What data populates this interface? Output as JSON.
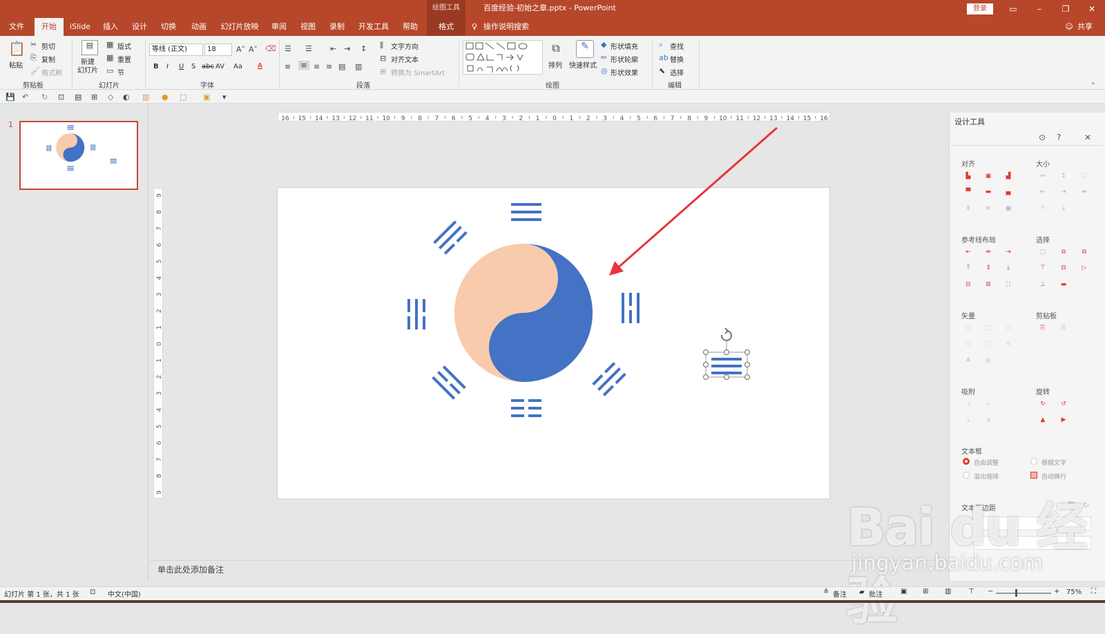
{
  "titlebar": {
    "context_group": "绘图工具",
    "document_title": "百度经验-初始之章.pptx  -  PowerPoint",
    "login_label": "登录",
    "share_label": "共享"
  },
  "tabs": [
    "文件",
    "开始",
    "iSlide",
    "插入",
    "设计",
    "切换",
    "动画",
    "幻灯片放映",
    "审阅",
    "视图",
    "录制",
    "开发工具",
    "帮助",
    "格式"
  ],
  "tell_me": "操作说明搜索",
  "ribbon": {
    "clipboard": {
      "label": "剪贴板",
      "paste": "粘贴",
      "cut": "剪切",
      "copy": "复制",
      "format_painter": "格式刷"
    },
    "slides": {
      "label": "幻灯片",
      "new_slide": "新建\n幻灯片",
      "layout": "版式",
      "reset": "重置",
      "section": "节"
    },
    "font": {
      "label": "字体",
      "font_name": "等线 (正文)",
      "font_size": "18",
      "bold": "B",
      "italic": "I",
      "underline": "U",
      "shadow": "S",
      "strike": "abc",
      "spacing": "AV",
      "case": "Aa",
      "color": "A"
    },
    "paragraph": {
      "label": "段落",
      "text_direction": "文字方向",
      "align_text": "对齐文本",
      "convert_smartart": "转换为 SmartArt"
    },
    "drawing": {
      "label": "绘图",
      "arrange": "排列",
      "quick_styles": "快速样式",
      "shape_fill": "形状填充",
      "shape_outline": "形状轮廓",
      "shape_effects": "形状效果"
    },
    "editing": {
      "label": "编辑",
      "find": "查找",
      "replace": "替换",
      "select": "选择"
    }
  },
  "slide_panel": {
    "slide_number": "1"
  },
  "notes_placeholder": "单击此处添加备注",
  "design_pane": {
    "title": "设计工具",
    "sections": {
      "align": "对齐",
      "size": "大小",
      "guide_layout": "参考线布局",
      "select": "选择",
      "vector": "矢量",
      "clipboard": "剪贴板",
      "snap": "吸附",
      "rotate": "旋转",
      "textbox": "文本框",
      "textbox_margin": "文本框边距"
    },
    "textbox_options": {
      "auto_fit": "自由调整",
      "fit_text": "根据文字",
      "overflow_shrink": "溢出缩排",
      "auto_wrap": "自动换行"
    }
  },
  "ruler": {
    "h_ticks": [
      "16",
      "15",
      "14",
      "13",
      "12",
      "11",
      "10",
      "9",
      "8",
      "7",
      "6",
      "5",
      "4",
      "3",
      "2",
      "1",
      "0",
      "1",
      "2",
      "3",
      "4",
      "5",
      "6",
      "7",
      "8",
      "9",
      "10",
      "11",
      "12",
      "13",
      "14",
      "15",
      "16"
    ],
    "v_ticks": [
      "9",
      "8",
      "7",
      "6",
      "5",
      "4",
      "3",
      "2",
      "1",
      "0",
      "1",
      "2",
      "3",
      "4",
      "5",
      "6",
      "7",
      "8",
      "9"
    ]
  },
  "statusbar": {
    "slide_info": "幻灯片 第 1 张，共 1 张",
    "language": "中文(中国)",
    "notes": "备注",
    "comments": "批注",
    "zoom": "75%"
  },
  "watermark": {
    "brand": "Bai du 经验",
    "url": "jingyan.baidu.com"
  },
  "colors": {
    "accent": "#b7472a",
    "yang_blue": "#4472c4",
    "yin_peach": "#f8cbad",
    "arrow_red": "#e8343a"
  }
}
